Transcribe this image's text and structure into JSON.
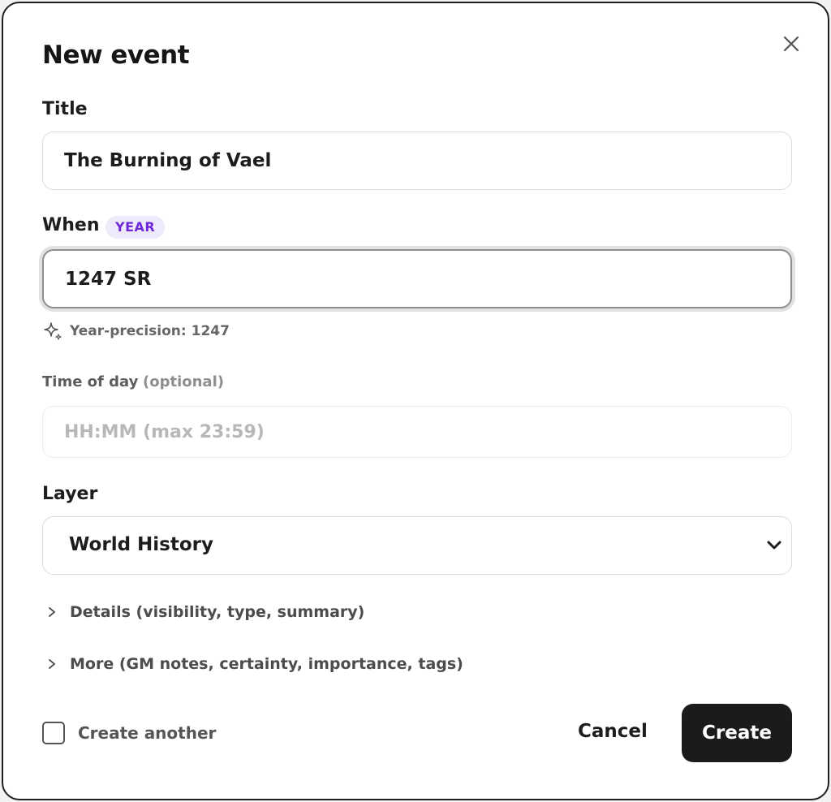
{
  "dialog": {
    "heading": "New event",
    "close_icon": "close-icon"
  },
  "form": {
    "title": {
      "label": "Title",
      "value": "The Burning of Vael"
    },
    "when": {
      "label": "When",
      "badge": "YEAR",
      "value": "1247 SR",
      "hint_icon": "sparkle-icon",
      "hint": "Year-precision: 1247"
    },
    "time_of_day": {
      "label": "Time of day",
      "optional": "(optional)",
      "placeholder": "HH:MM (max 23:59)",
      "value": ""
    },
    "layer": {
      "label": "Layer",
      "value": "World History",
      "icon": "chevron-down-icon"
    },
    "sections": [
      {
        "label": "Details (visibility, type, summary)",
        "icon": "chevron-right-icon"
      },
      {
        "label": "More (GM notes, certainty, importance, tags)",
        "icon": "chevron-right-icon"
      }
    ]
  },
  "footer": {
    "create_another": "Create another",
    "create_another_checked": false,
    "cancel": "Cancel",
    "create": "Create"
  },
  "colors": {
    "badge_bg": "#efe9fc",
    "badge_text": "#6d28d9",
    "primary_button": "#1b1b1b",
    "border": "#dcdcdc"
  }
}
